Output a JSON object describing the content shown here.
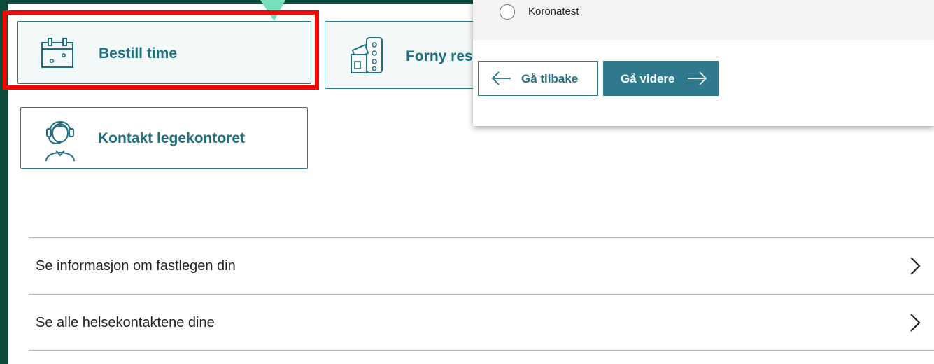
{
  "cards": {
    "book": {
      "label": "Bestill time",
      "icon": "calendar-icon"
    },
    "renew": {
      "label": "Forny resept",
      "icon": "medicine-icon"
    },
    "contact": {
      "label": "Kontakt legekontoret",
      "icon": "headset-person-icon"
    }
  },
  "nav": {
    "items": [
      {
        "label": "Se informasjon om fastlegen din"
      },
      {
        "label": "Se alle helsekontaktene dine"
      }
    ]
  },
  "modal": {
    "option": {
      "label": "Koronatest",
      "selected": false
    },
    "back_label": "Gå tilbake",
    "next_label": "Gå videre"
  },
  "colors": {
    "accent": "#2e7a8c",
    "background_dark": "#0c4a3c",
    "highlight": "#ff0000",
    "callout": "#79e0bd"
  }
}
